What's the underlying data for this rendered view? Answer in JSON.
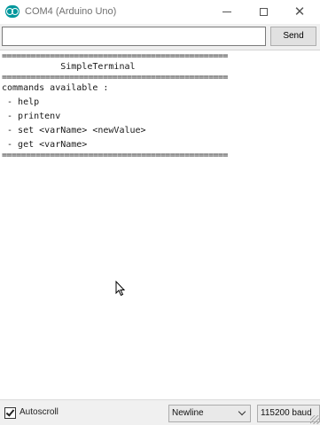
{
  "window": {
    "title": "COM4 (Arduino Uno)",
    "close_glyph": "✕"
  },
  "send": {
    "input_value": "",
    "button_label": "Send"
  },
  "output": {
    "lines": [
      "===============================================",
      "           SimpleTerminal",
      "===============================================",
      "commands available :",
      " - help",
      " - printenv",
      " - set <varName> <newValue>",
      " - get <varName>",
      "==============================================="
    ]
  },
  "statusbar": {
    "autoscroll_label": "Autoscroll",
    "autoscroll_checked": true,
    "line_ending": "Newline",
    "baud_rate": "115200 baud"
  },
  "colors": {
    "logo": "#00979c",
    "chrome": "#f0f0f0"
  }
}
